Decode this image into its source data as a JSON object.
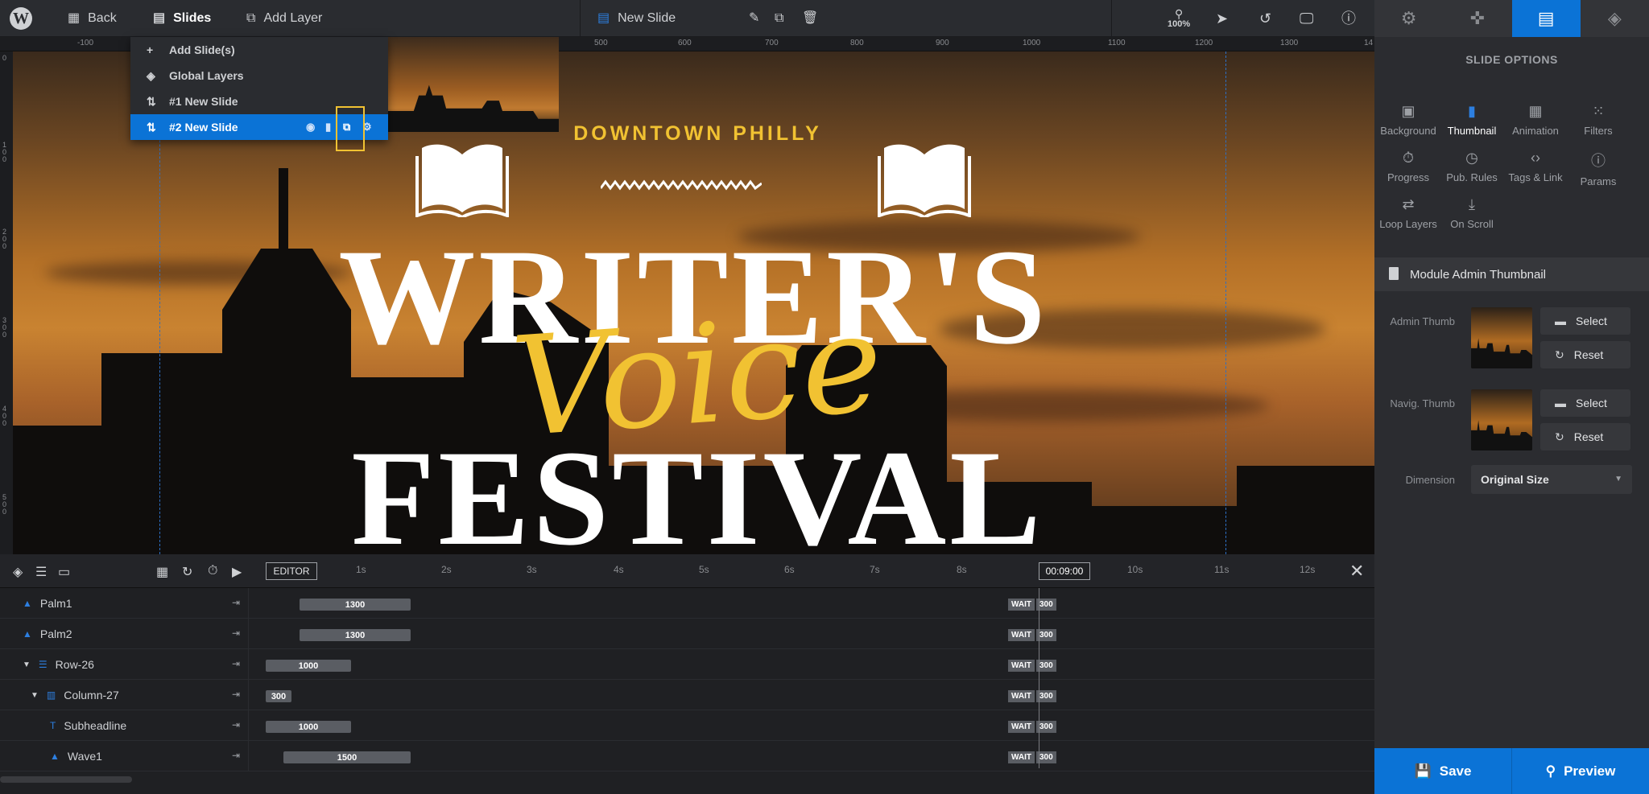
{
  "topbar": {
    "back_label": "Back",
    "slides_label": "Slides",
    "add_layer_label": "Add Layer",
    "slide_name": "New Slide",
    "zoom": "100%"
  },
  "slide_menu": {
    "items": [
      {
        "label": "Add Slide(s)",
        "icon": "plus-icon"
      },
      {
        "label": "Global Layers",
        "icon": "layers-icon"
      },
      {
        "label": "#1 New Slide",
        "icon": "sort-icon"
      },
      {
        "label": "#2 New Slide",
        "icon": "sort-icon",
        "selected": true
      }
    ]
  },
  "ruler": {
    "ticks": [
      "-100",
      "500",
      "600",
      "700",
      "800",
      "900",
      "1000",
      "1100",
      "1200",
      "1300",
      "14"
    ],
    "vticks": [
      "0",
      "1\n0\n0",
      "2\n0\n0",
      "3\n0\n0",
      "4\n0\n0",
      "5\n0\n0"
    ]
  },
  "canvas": {
    "tagline": "DOWNTOWN PHILLY",
    "headline_top": "WRITER'S",
    "headline_script": "Voice",
    "headline_bottom": "FESTIVAL",
    "accent_color": "#f1c232"
  },
  "right_panel": {
    "title": "SLIDE OPTIONS",
    "options": [
      {
        "label": "Background",
        "icon": "image-icon"
      },
      {
        "label": "Thumbnail",
        "icon": "bookmark-icon",
        "active": true
      },
      {
        "label": "Animation",
        "icon": "film-icon"
      },
      {
        "label": "Filters",
        "icon": "grid-dots-icon"
      },
      {
        "label": "Progress",
        "icon": "stopwatch-icon"
      },
      {
        "label": "Pub. Rules",
        "icon": "clock-icon"
      },
      {
        "label": "Tags & Link",
        "icon": "code-icon"
      },
      {
        "label": "Params",
        "icon": "info-icon"
      },
      {
        "label": "Loop Layers",
        "icon": "loop-icon"
      },
      {
        "label": "On Scroll",
        "icon": "download-icon"
      }
    ],
    "section_title": "Module Admin Thumbnail",
    "admin_thumb_label": "Admin Thumb",
    "navig_thumb_label": "Navig. Thumb",
    "select_label": "Select",
    "reset_label": "Reset",
    "dimension_label": "Dimension",
    "dimension_value": "Original Size",
    "save_label": "Save",
    "preview_label": "Preview"
  },
  "timeline": {
    "editor_label": "EDITOR",
    "seconds": [
      "1s",
      "2s",
      "3s",
      "4s",
      "5s",
      "6s",
      "7s",
      "8s",
      "10s",
      "11s",
      "12s"
    ],
    "current_time": "00:09:00",
    "wait_label": "WAIT",
    "rows": [
      {
        "name": "Palm1",
        "duration": "1300",
        "wait": "300"
      },
      {
        "name": "Palm2",
        "duration": "1300",
        "wait": "300"
      },
      {
        "name": "Row-26",
        "duration": "1000",
        "wait": "300"
      },
      {
        "name": "Column-27",
        "duration": "300",
        "wait": "300"
      },
      {
        "name": "Subheadline",
        "duration": "1000",
        "wait": "300"
      },
      {
        "name": "Wave1",
        "duration": "1500",
        "wait": "300"
      }
    ]
  }
}
